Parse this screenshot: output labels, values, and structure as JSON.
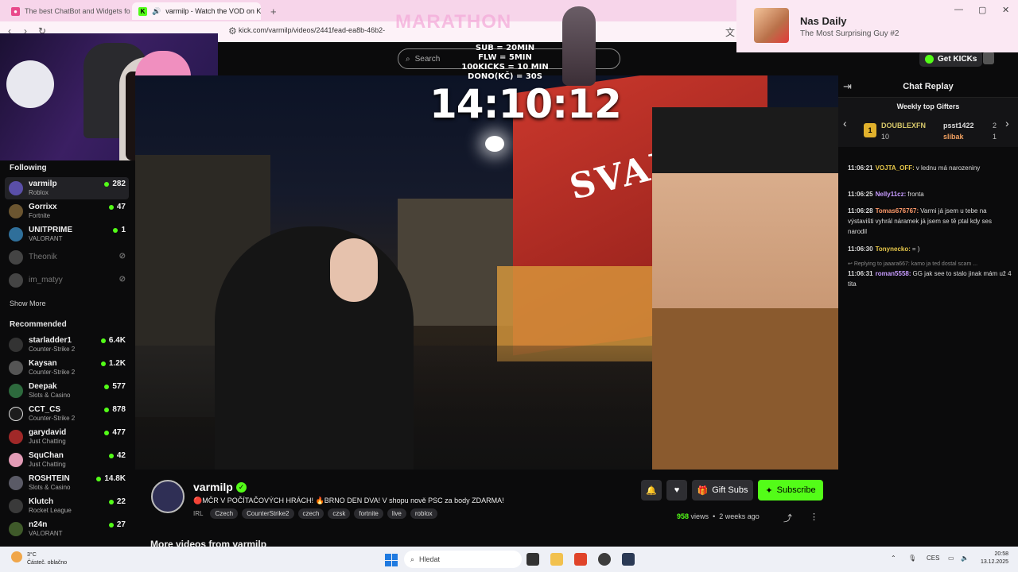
{
  "browser": {
    "tabs": [
      {
        "title": "The best ChatBot and Widgets for Ki",
        "active": false
      },
      {
        "title": "varmilp - Watch the VOD on K",
        "active": true
      }
    ],
    "new_tab": "+",
    "url": "kick.com/varmilp/videos/2441fead-ea8b-46b2-",
    "window_controls": [
      "—",
      "▢",
      "✕"
    ]
  },
  "nas_popup": {
    "name": "Nas Daily",
    "subtitle": "The Most Surprising Guy #2"
  },
  "header": {
    "search_placeholder": "Search",
    "get_kicks": "Get KICKs"
  },
  "stream_overlay": {
    "marathon": "MARATHON",
    "rules": [
      "SUB = 20MIN",
      "FLW = 5MIN",
      "100KICKS = 10 MIN",
      "DONO(KČ) = 30S"
    ],
    "timer": "14:10:12"
  },
  "video_sign": "SVAŘÁ",
  "sidebar": {
    "following_label": "Following",
    "following": [
      {
        "name": "varmilp",
        "category": "Roblox",
        "viewers": "282",
        "live": true,
        "selected": true
      },
      {
        "name": "Gorrixx",
        "category": "Fortnite",
        "viewers": "47",
        "live": true
      },
      {
        "name": "UNITPRIME",
        "category": "VALORANT",
        "viewers": "1",
        "live": true
      },
      {
        "name": "Theonik",
        "category": "",
        "viewers": "",
        "live": false
      },
      {
        "name": "im_matyy",
        "category": "",
        "viewers": "",
        "live": false
      }
    ],
    "show_more": "Show More",
    "recommended_label": "Recommended",
    "recommended": [
      {
        "name": "starladder1",
        "category": "Counter-Strike 2",
        "viewers": "6.4K"
      },
      {
        "name": "Kaysan",
        "category": "Counter-Strike 2",
        "viewers": "1.2K"
      },
      {
        "name": "Deepak",
        "category": "Slots & Casino",
        "viewers": "577"
      },
      {
        "name": "CCT_CS",
        "category": "Counter-Strike 2",
        "viewers": "878"
      },
      {
        "name": "garydavid",
        "category": "Just Chatting",
        "viewers": "477"
      },
      {
        "name": "SquChan",
        "category": "Just Chatting",
        "viewers": "42"
      },
      {
        "name": "ROSHTEIN",
        "category": "Slots & Casino",
        "viewers": "14.8K"
      },
      {
        "name": "Klutch",
        "category": "Rocket League",
        "viewers": "22"
      },
      {
        "name": "n24n",
        "category": "VALORANT",
        "viewers": "27"
      }
    ]
  },
  "chat": {
    "title": "Chat Replay",
    "gifters_title": "Weekly top Gifters",
    "gifters": [
      {
        "rank": "1",
        "name": "DOUBLEXFN",
        "count": "10"
      },
      {
        "rank": "2",
        "name": "psst1422",
        "count": "2"
      },
      {
        "rank": "3",
        "name": "slibak",
        "count": "1"
      }
    ],
    "messages": [
      {
        "time": "11:06:21",
        "user": "VOJTA_OFF:",
        "text": "v lednu má narozeniny",
        "color": "#e7c84a"
      },
      {
        "time": "11:06:25",
        "user": "Nelly11cz:",
        "text": "fronta",
        "color": "#c79bff"
      },
      {
        "time": "11:06:28",
        "user": "Tomas676767:",
        "text": "Varmi já jsem u tebe na výstavišti vyhrál náramek já jsem se tě ptal kdy ses narodil",
        "color": "#ff9a6a"
      },
      {
        "time": "11:06:30",
        "user": "Tonynecko:",
        "text": "= )",
        "color": "#e7c84a"
      },
      {
        "time": "",
        "user": "",
        "text": "Replying to jaaara667: kamo ja ted dostal scam ...",
        "color": "#888"
      },
      {
        "time": "11:06:31",
        "user": "roman5558:",
        "text": "GG jak see to stalo jinak mám už 4 tita",
        "color": "#c79bff"
      }
    ]
  },
  "video_info": {
    "channel": "varmilp",
    "title": "🔴MČR V POČÍTAČOVÝCH HRÁCH! 🔥BRNO DEN DVA! V shopu nově PSC za body ZDARMA!",
    "category": "IRL",
    "tags": [
      "Czech",
      "CounterStrike2",
      "czech",
      "czsk",
      "fortnite",
      "live",
      "roblox"
    ],
    "gift_subs": "Gift Subs",
    "subscribe": "Subscribe",
    "views_count": "958",
    "views_label": "views",
    "ago": "2 weeks ago",
    "more_videos": "More videos from varmilp"
  },
  "taskbar": {
    "weather_temp": "3°C",
    "weather_desc": "Částeč. oblačno",
    "search": "Hledat",
    "lang": "CES",
    "time": "20:58",
    "date": "13.12.2025"
  },
  "colors": {
    "kick_green": "#53fc18",
    "tab_bar": "#f7d5ea",
    "background": "#0b0b0c"
  }
}
